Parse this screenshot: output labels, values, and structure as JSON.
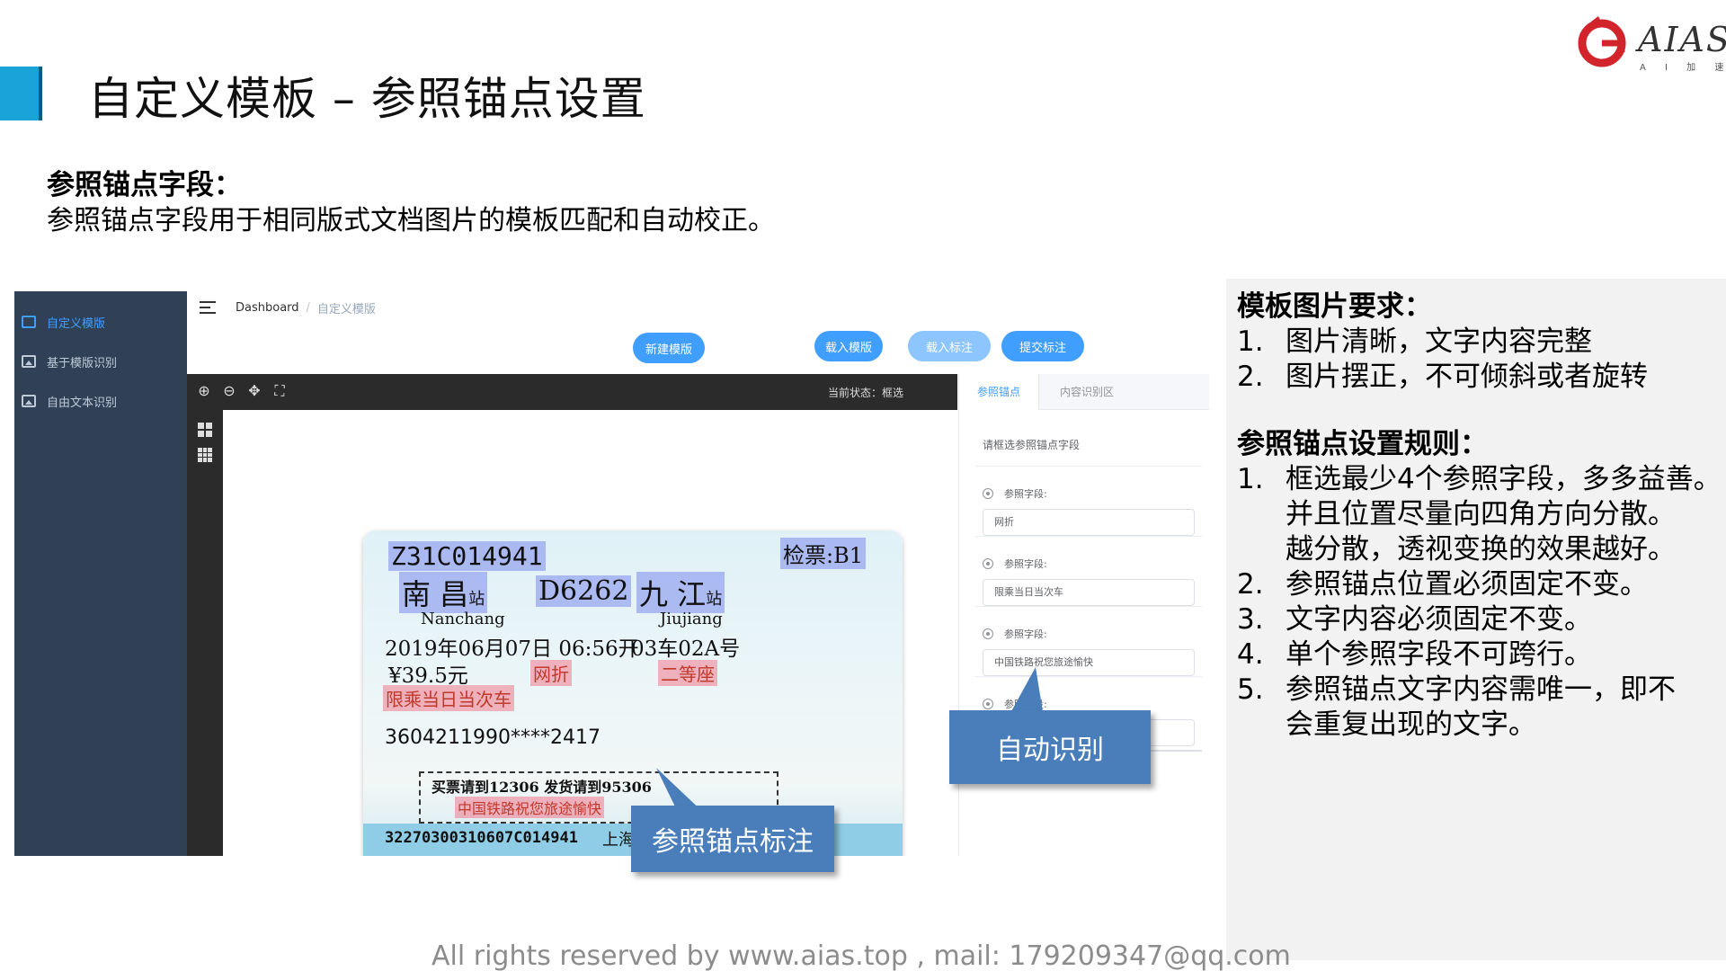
{
  "slide": {
    "title": "自定义模板 – 参照锚点设置",
    "logo_word": "AIAS",
    "logo_sub": "A I 加 速 器",
    "intro_heading": "参照锚点字段：",
    "intro_body": "参照锚点字段用于相同版式文档图片的模板匹配和自动校正。",
    "footer": "All rights reserved by www.aias.top , mail: 179209347@qq.com"
  },
  "app": {
    "sidebar": {
      "items": [
        {
          "label": "自定义模版",
          "icon": "template-icon",
          "active": true
        },
        {
          "label": "基于模版识别",
          "icon": "image-icon",
          "active": false
        },
        {
          "label": "自由文本识别",
          "icon": "image-icon",
          "active": false
        }
      ]
    },
    "breadcrumb": {
      "home": "Dashboard",
      "separator": "/",
      "current": "自定义模版"
    },
    "toolbar": {
      "new_template": "新建模版",
      "load_template": "载入模版",
      "load_annotation": "载入标注",
      "submit_annotation": "提交标注"
    },
    "editor": {
      "status_label": "当前状态：",
      "status_value": "框选"
    },
    "tabs": [
      {
        "label": "参照锚点",
        "active": true
      },
      {
        "label": "内容识别区",
        "active": false
      }
    ],
    "form": {
      "title": "请框选参照锚点字段",
      "fields": [
        {
          "label": "参照字段:",
          "value": "网折"
        },
        {
          "label": "参照字段:",
          "value": "限乘当日当次车"
        },
        {
          "label": "参照字段:",
          "value": "中国铁路祝您旅途愉快"
        },
        {
          "label": "参照字段:",
          "value": ""
        }
      ]
    }
  },
  "ticket": {
    "serial": "Z31C014941",
    "check": "检票:B1",
    "from_station": "南  昌",
    "from_suffix": "站",
    "train": "D6262",
    "to_station": "九  江",
    "to_suffix": "站",
    "from_pinyin": "Nanchang",
    "to_pinyin": "Jiujiang",
    "date_time": "2019年06月07日 06:56开",
    "seat": "03车02A号",
    "price": "¥39.5元",
    "discount": "网折",
    "seat_class": "二等座",
    "limit": "限乘当日当次车",
    "id_number": "3604211990****2417",
    "notice": "买票请到12306  发货请到95306",
    "slogan": "中国铁路祝您旅途愉快",
    "barcode_text": "32270300310607C014941",
    "issue_station": "上海南售"
  },
  "callouts": {
    "auto": "自动识别",
    "anchor": "参照锚点标注"
  },
  "info": {
    "requirements_heading": "模板图片要求：",
    "requirements": [
      {
        "num": "1.",
        "text": "图片清晰，文字内容完整"
      },
      {
        "num": "2.",
        "text": "图片摆正，不可倾斜或者旋转"
      }
    ],
    "rules_heading": "参照锚点设置规则：",
    "rules": [
      {
        "num": "1.",
        "text": "框选最少4个参照字段，多多益善。\n并且位置尽量向四角方向分散。\n越分散，透视变换的效果越好。"
      },
      {
        "num": "2.",
        "text": "参照锚点位置必须固定不变。"
      },
      {
        "num": "3.",
        "text": "文字内容必须固定不变。"
      },
      {
        "num": "4.",
        "text": "单个参照字段不可跨行。"
      },
      {
        "num": "5.",
        "text": "参照锚点文字内容需唯一，即不\n会重复出现的文字。"
      }
    ]
  },
  "colors": {
    "accent": "#1aa3d9",
    "sidebar_bg": "#304156",
    "primary_button": "#409eff",
    "callout": "#4a7ebb"
  }
}
